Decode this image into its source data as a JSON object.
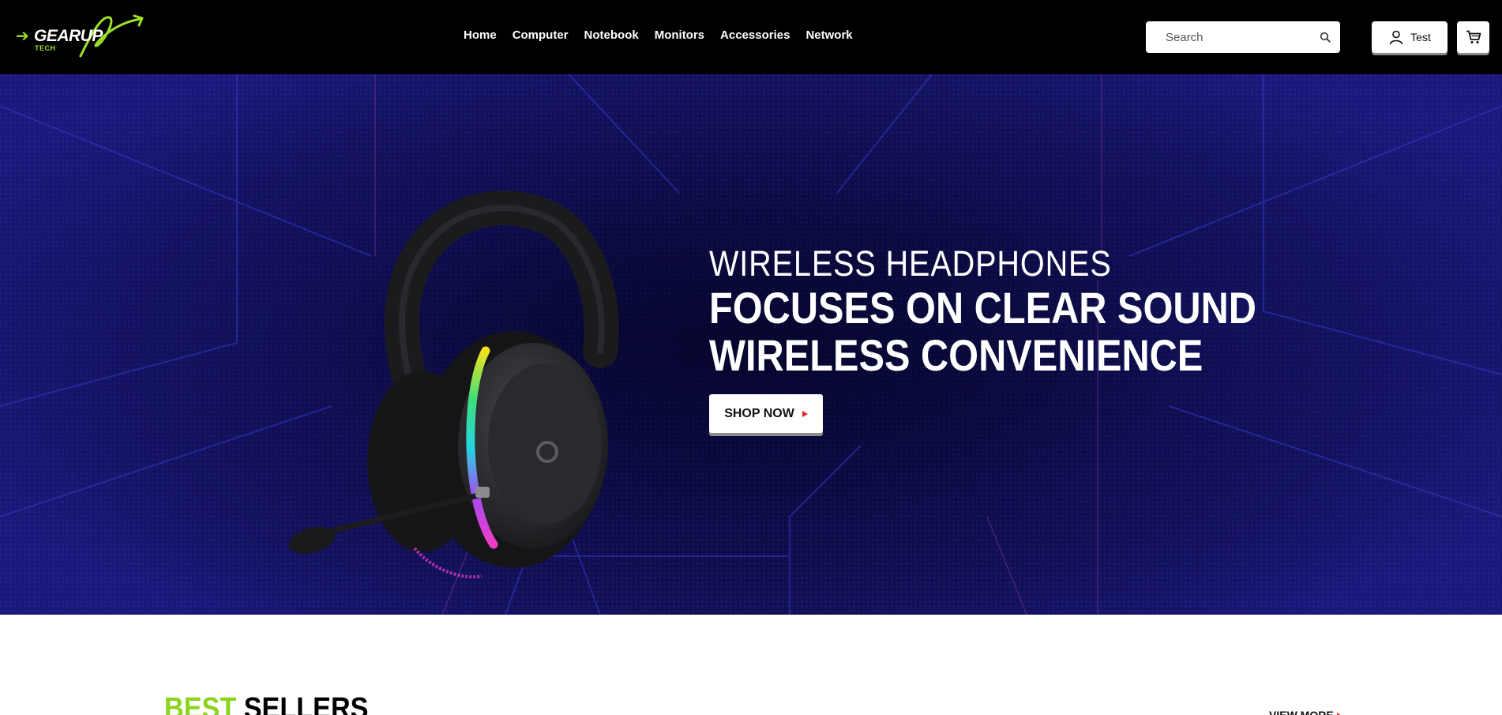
{
  "brand": {
    "name": "GEARUP",
    "sub": "TECH",
    "accent_color": "#9be12a"
  },
  "nav": {
    "items": [
      {
        "label": "Home"
      },
      {
        "label": "Computer"
      },
      {
        "label": "Notebook"
      },
      {
        "label": "Monitors"
      },
      {
        "label": "Accessories"
      },
      {
        "label": "Network"
      }
    ]
  },
  "search": {
    "placeholder": "Search",
    "icon": "search-icon"
  },
  "account": {
    "label": "Test",
    "icon": "user-icon"
  },
  "cart": {
    "icon": "cart-icon"
  },
  "hero": {
    "subtitle": "WIRELESS HEADPHONES",
    "title_line1": "FOCUSES ON CLEAR SOUND",
    "title_line2": "WIRELESS CONVENIENCE",
    "cta_label": "SHOP NOW",
    "cta_arrow_color": "#e8232a",
    "background_color": "#14125e",
    "image": "wireless-headphones"
  },
  "best_sellers": {
    "title_accent": "BEST",
    "title_rest": "SELLERS",
    "title_accent_color": "#8cd41e",
    "view_more_label": "VIEW MORE"
  }
}
